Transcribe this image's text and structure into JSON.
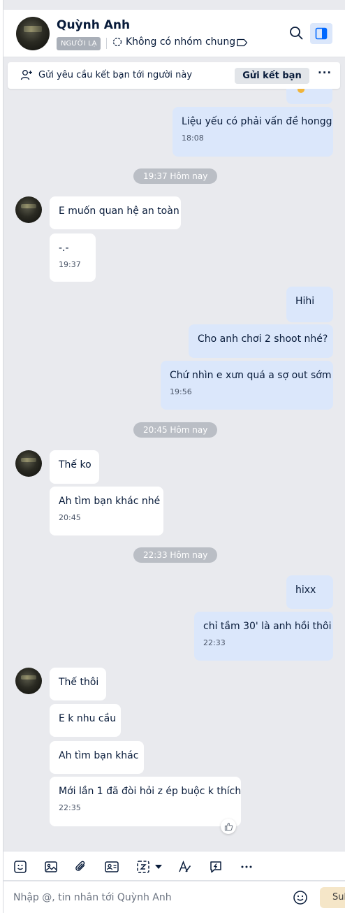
{
  "header": {
    "name": "Quỳnh Anh",
    "tag": "NGƯỜI LẠ",
    "group_status": "Không có nhóm chung"
  },
  "friend_bar": {
    "text": "Gửi yêu cầu kết bạn tới người này",
    "button": "Gửi kết bạn",
    "more": "···"
  },
  "messages": [
    {
      "text": "Liệu yếu có phải vấn đề hongg",
      "time": "18:08"
    },
    {
      "divider": "19:37 Hôm nay"
    },
    {
      "text": "E muốn quan hệ an toàn"
    },
    {
      "text": "-.-",
      "time": "19:37"
    },
    {
      "text": "Hihi"
    },
    {
      "text": "Cho anh chơi 2 shoot nhé?"
    },
    {
      "text": "Chứ nhìn e xưn quá a sợ out sớm",
      "time": "19:56"
    },
    {
      "divider": "20:45 Hôm nay"
    },
    {
      "text": "Thế ko"
    },
    {
      "text": "Ah tìm bạn khác nhé",
      "time": "20:45"
    },
    {
      "divider": "22:33 Hôm nay"
    },
    {
      "text": "hixx"
    },
    {
      "text": "chỉ tầm 30' là anh hồi thôi",
      "time": "22:33"
    },
    {
      "text": "Thế thôi"
    },
    {
      "text": "E k nhu cầu"
    },
    {
      "text": "Ah tìm bạn khác"
    },
    {
      "text": "Mới lần 1 đã đòi hỏi z ép buộc k thích",
      "time": "22:35"
    }
  ],
  "composer": {
    "placeholder": "Nhập @, tin nhắn tới Quỳnh Anh",
    "send_label": "Sub"
  },
  "colors": {
    "outgoing": "#dbe7fb",
    "incoming": "#ffffff",
    "background": "#e9eaee",
    "accent": "#0068ff"
  }
}
